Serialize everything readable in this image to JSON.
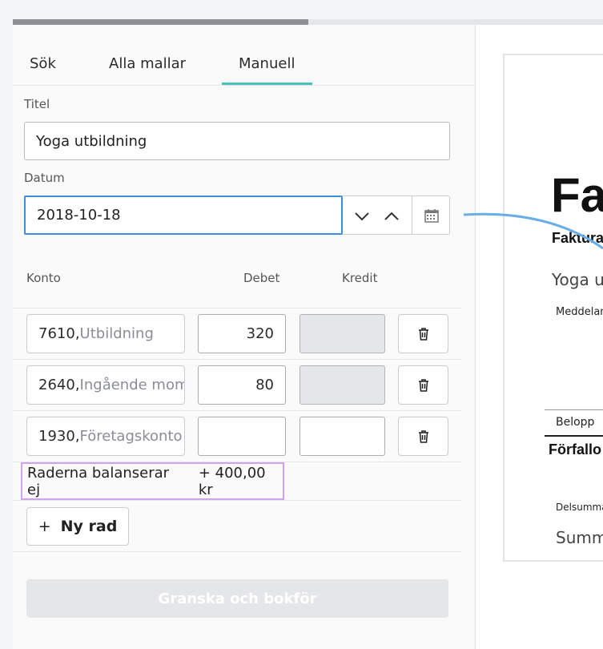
{
  "progress": 0.5,
  "tabs": [
    {
      "label": "Sök",
      "active": false
    },
    {
      "label": "Alla mallar",
      "active": false
    },
    {
      "label": "Manuell",
      "active": true
    }
  ],
  "form": {
    "title_label": "Titel",
    "title_value": "Yoga utbildning",
    "date_label": "Datum",
    "date_value": "2018-10-18"
  },
  "table": {
    "headers": {
      "konto": "Konto",
      "debet": "Debet",
      "kredit": "Kredit"
    },
    "rows": [
      {
        "account": "7610",
        "name": "Utbildning",
        "debet": "320",
        "kredit": "",
        "kredit_disabled": true
      },
      {
        "account": "2640",
        "name": "Ingående moms",
        "debet": "80",
        "kredit": "",
        "kredit_disabled": true
      },
      {
        "account": "1930",
        "name": "Företagskonto",
        "debet": "",
        "kredit": "",
        "kredit_disabled": false
      }
    ]
  },
  "balance": {
    "message": "Raderna balanserar ej",
    "amount": "+ 400,00 kr"
  },
  "buttons": {
    "add_row": "Ny rad",
    "add_icon": "+",
    "submit": "Granska och bokför"
  },
  "invoice_preview": {
    "heading": "Fak",
    "subheading": "Faktura",
    "title": "Yoga ut",
    "message_label": "Meddelande",
    "amount_label": "Belopp",
    "due_label": "Förfallo",
    "subtotal_label": "Delsumma",
    "total_label": "Summa"
  },
  "colors": {
    "accent": "#47c1b5",
    "focus": "#3f8fde",
    "highlight": "#d0a3ee",
    "connector": "#6aaee8"
  },
  "icons": [
    "chevron-down-icon",
    "chevron-up-icon",
    "calendar-icon",
    "trash-icon",
    "plus-icon"
  ]
}
